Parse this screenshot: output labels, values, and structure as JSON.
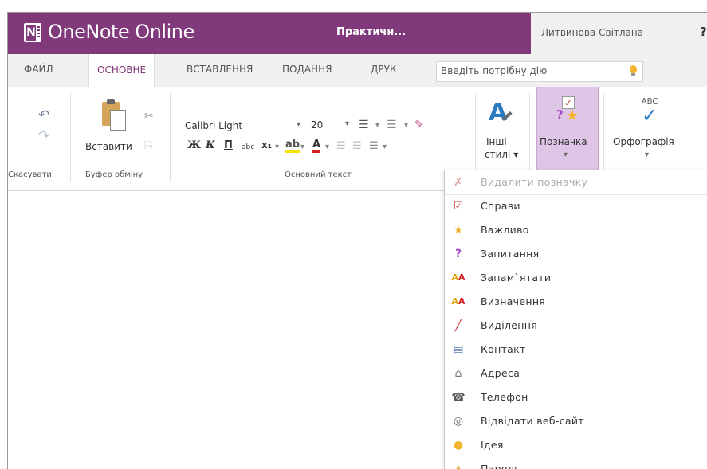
{
  "app": {
    "name": "OneNote Online",
    "document_title": "Практичн...",
    "user": "Литвинова Світлана",
    "help": "?"
  },
  "tabs": [
    {
      "label": "ФАЙЛ"
    },
    {
      "label": "ОСНОВНЕ"
    },
    {
      "label": "ВСТАВЛЕННЯ"
    },
    {
      "label": "ПОДАННЯ"
    },
    {
      "label": "ДРУК"
    }
  ],
  "tell_me": {
    "placeholder": "Введіть потрібну дію"
  },
  "ribbon": {
    "undo_group_label": "Скасувати",
    "clipboard": {
      "paste_label": "Вставити",
      "group_label": "Буфер обміну"
    },
    "basic_text": {
      "font_name": "Calibri Light",
      "font_size": "20",
      "group_label": "Основний текст",
      "bold": "Ж",
      "italic": "К",
      "underline": "П",
      "strikethrough": "abc",
      "subscript": "x₁"
    },
    "styles": {
      "label_line1": "Інші",
      "label_line2": "стилі ▾"
    },
    "tag": {
      "label": "Позначка",
      "arrow": "▾"
    },
    "spelling": {
      "abc": "ABC",
      "label": "Орфографія",
      "arrow": "▾"
    }
  },
  "tag_menu": {
    "items": [
      {
        "label": "Видалити позначку",
        "icon": "remove-tag-icon",
        "glyph": "✗",
        "color": "#e3a0a0",
        "disabled": true
      },
      {
        "label": "Справи",
        "icon": "checkbox-icon",
        "glyph": "☑",
        "color": "#c0392b"
      },
      {
        "label": "Важливо",
        "icon": "star-icon",
        "glyph": "★",
        "color": "#f0b030"
      },
      {
        "label": "Запитання",
        "icon": "question-icon",
        "glyph": "?",
        "color": "#a44dc6"
      },
      {
        "label": "Запам`ятати",
        "icon": "remember-icon",
        "glyph": "A",
        "color": "#e0a000"
      },
      {
        "label": "Визначення",
        "icon": "definition-icon",
        "glyph": "A",
        "color": "#e0a000"
      },
      {
        "label": "Виділення",
        "icon": "highlight-icon",
        "glyph": "╱",
        "color": "#d04040"
      },
      {
        "label": "Контакт",
        "icon": "contact-icon",
        "glyph": "▤",
        "color": "#5a7fb5"
      },
      {
        "label": "Адреса",
        "icon": "home-icon",
        "glyph": "⌂",
        "color": "#777777"
      },
      {
        "label": "Телефон",
        "icon": "phone-icon",
        "glyph": "☎",
        "color": "#555555"
      },
      {
        "label": "Відвідати веб-сайт",
        "icon": "globe-icon",
        "glyph": "◎",
        "color": "#666666"
      },
      {
        "label": "Ідея",
        "icon": "lightbulb-icon",
        "glyph": "●",
        "color": "#f2b72f"
      },
      {
        "label": "Пароль",
        "icon": "lock-icon",
        "glyph": "▲",
        "color": "#e8b040"
      }
    ]
  },
  "colors": {
    "brand": "#80397b",
    "tag_highlight": "#dfc6e6",
    "accent_blue": "#2b79c2"
  }
}
